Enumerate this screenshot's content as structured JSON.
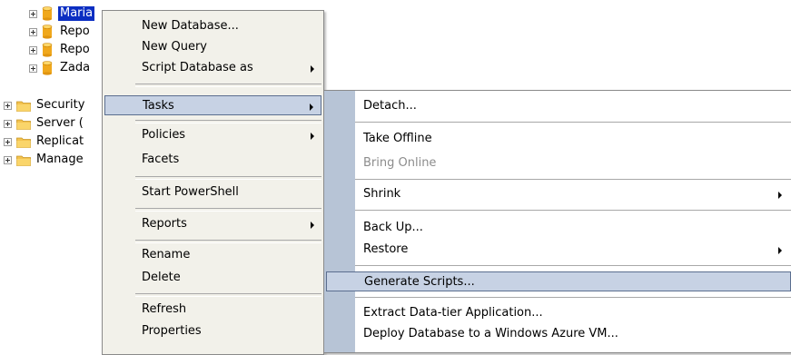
{
  "tree": {
    "databases": [
      {
        "label": "Maria",
        "selected": true
      },
      {
        "label": "Repo",
        "selected": false
      },
      {
        "label": "Repo",
        "selected": false
      },
      {
        "label": "Zada",
        "selected": false
      }
    ],
    "folders": [
      {
        "label": "Security"
      },
      {
        "label": "Server ("
      },
      {
        "label": "Replicat"
      },
      {
        "label": "Manage"
      }
    ]
  },
  "context_menu": {
    "new_database": "New Database...",
    "new_query": "New Query",
    "script_database_as": "Script Database as",
    "tasks": "Tasks",
    "policies": "Policies",
    "facets": "Facets",
    "start_powershell": "Start PowerShell",
    "reports": "Reports",
    "rename": "Rename",
    "delete": "Delete",
    "refresh": "Refresh",
    "properties": "Properties"
  },
  "tasks_submenu": {
    "detach": "Detach...",
    "take_offline": "Take Offline",
    "bring_online": "Bring Online",
    "shrink": "Shrink",
    "back_up": "Back Up...",
    "restore": "Restore",
    "generate_scripts": "Generate Scripts...",
    "extract_data_tier": "Extract Data-tier Application...",
    "deploy_azure_vm": "Deploy Database to a Windows Azure VM..."
  },
  "colors": {
    "selection": "#0b2ec2",
    "menu_gutter": "#b7c4d6",
    "menu_highlight": "#c7d2e4",
    "database_icon": "#f0a81c",
    "folder_icon": "#f3c24f"
  }
}
